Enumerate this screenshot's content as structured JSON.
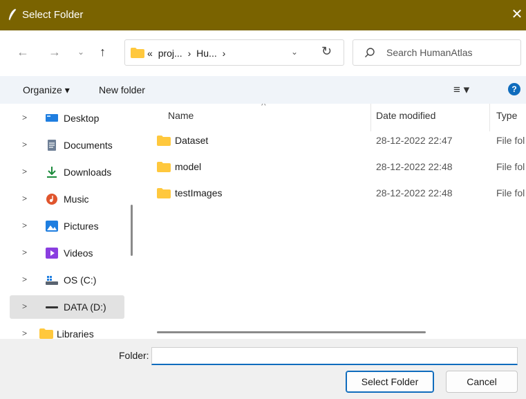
{
  "window": {
    "title": "Select Folder",
    "close_glyph": "✕"
  },
  "nav": {
    "back": "←",
    "forward": "→",
    "recent": "⌄",
    "up": "↑",
    "address": [
      "«",
      "proj...",
      "›",
      "Hu...",
      "›"
    ],
    "address_dropdown": "⌄",
    "refresh": "↻",
    "search_placeholder": "Search HumanAtlas"
  },
  "toolbar": {
    "organize": "Organize ▾",
    "new_folder": "New folder",
    "view": "≡ ▾",
    "help": "?"
  },
  "sidebar": {
    "items": [
      {
        "label": "Desktop",
        "icon": "desktop-icon",
        "color": "#1f7ee0"
      },
      {
        "label": "Documents",
        "icon": "documents-icon",
        "color": "#6e7f96"
      },
      {
        "label": "Downloads",
        "icon": "downloads-icon",
        "color": "#1a8a3a"
      },
      {
        "label": "Music",
        "icon": "music-icon",
        "color": "#e0552d"
      },
      {
        "label": "Pictures",
        "icon": "pictures-icon",
        "color": "#1f7ee0"
      },
      {
        "label": "Videos",
        "icon": "videos-icon",
        "color": "#8a3ee0"
      },
      {
        "label": "OS (C:)",
        "icon": "drive-icon",
        "color": "#5a6470"
      },
      {
        "label": "DATA (D:)",
        "icon": "drive-icon",
        "color": "#333333"
      },
      {
        "label": "Libraries",
        "icon": "folder-icon",
        "color": "#ffc83d"
      }
    ],
    "selected": "DATA (D:)"
  },
  "files": {
    "columns": {
      "name": "Name",
      "date": "Date modified",
      "type": "Type"
    },
    "rows": [
      {
        "name": "Dataset",
        "date": "28-12-2022 22:47",
        "type": "File fol"
      },
      {
        "name": "model",
        "date": "28-12-2022 22:48",
        "type": "File fol"
      },
      {
        "name": "testImages",
        "date": "28-12-2022 22:48",
        "type": "File fol"
      }
    ]
  },
  "bottom": {
    "folder_label": "Folder:",
    "folder_value": "",
    "select_button": "Select Folder",
    "cancel_button": "Cancel"
  },
  "colors": {
    "titlebar": "#7a6300",
    "accent": "#0f6cbd",
    "folder": "#ffc83d"
  }
}
